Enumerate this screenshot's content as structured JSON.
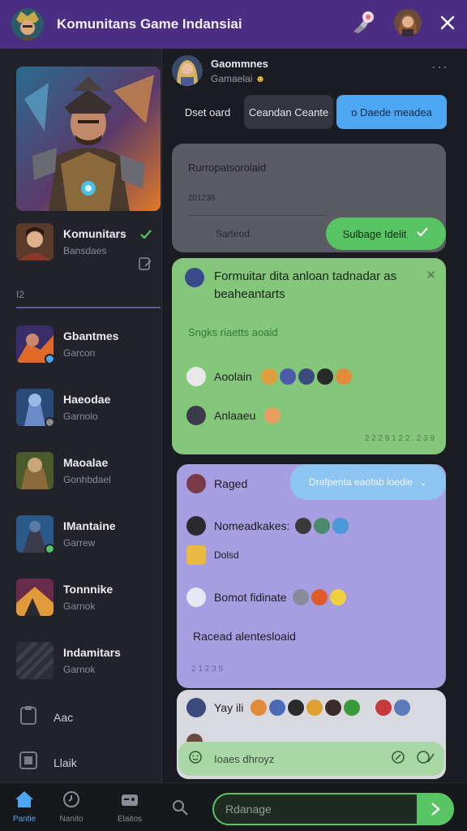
{
  "header": {
    "title": "Komunitans Game Indansiai"
  },
  "sidebar": {
    "active": {
      "name": "Komunitars",
      "sub": "Bansdaes"
    },
    "section_label": "I2",
    "items": [
      {
        "name": "Gbantmes",
        "sub": "Garcon"
      },
      {
        "name": "Haeodae",
        "sub": "Garnolo"
      },
      {
        "name": "Maoalae",
        "sub": "Gonhbdael"
      },
      {
        "name": "IMantaine",
        "sub": "Garrew"
      },
      {
        "name": "Tonnnike",
        "sub": "Garnok"
      },
      {
        "name": "Indamitars",
        "sub": "Garnok"
      }
    ],
    "links": [
      {
        "label": "Aac"
      },
      {
        "label": "Llaik"
      }
    ]
  },
  "chat": {
    "title": "Gaommnes",
    "subtitle": "Gamaelai",
    "tabs": [
      {
        "label": "Dset oard"
      },
      {
        "label": "Ceandan Ceante"
      },
      {
        "label": "o Daede meadea"
      }
    ],
    "bubble1": {
      "title": "Rurropatsorolaid",
      "meta": "201238",
      "footer": "Sarteod.",
      "badge": "Sulbage Idelit"
    },
    "bubble2": {
      "text": "Formuitar dita anloan tadnadar as beaheantarts",
      "subhead": "Sngks riaetts aoaid",
      "line1": "Aoolain",
      "line2": "Anlaaeu",
      "time": "2 2 2 9 1 2 2 . 2 3 9"
    },
    "bubble3": {
      "pill": "Drafpenta eaofab loedie",
      "line1": "Raged",
      "line2": "Nomeadkakes:",
      "line3": "Dolsd",
      "line4": "Bomot fidinate",
      "line5": "Racead alentesloaid",
      "time": "2 1 2 3 5"
    },
    "bubble4": {
      "line1": "Yay ili",
      "input_placeholder": "Ioaes dhroyz"
    }
  },
  "composer": {
    "placeholder": "Rdanage"
  },
  "nav": [
    {
      "label": "Pantie"
    },
    {
      "label": "Nanito"
    },
    {
      "label": "Elaitos"
    }
  ],
  "colors": {
    "topbar": "#4b2d82",
    "accent_green": "#58c464",
    "bubble_green": "#85c77a",
    "bubble_purple": "#a69ee0",
    "tab_active": "#4ea7f2"
  }
}
